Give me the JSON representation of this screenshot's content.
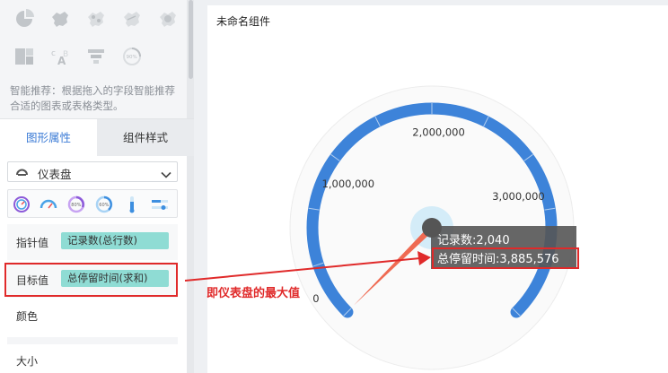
{
  "left_panel": {
    "recommend_text": "智能推荐：根据拖入的字段智能推荐合适的图表或表格类型。",
    "tabs": [
      {
        "label": "图形属性",
        "active": true
      },
      {
        "label": "组件样式",
        "active": false
      }
    ],
    "chart_type_select": {
      "value": "仪表盘"
    },
    "fields": {
      "pointer": {
        "label": "指针值",
        "value": "记录数(总行数)"
      },
      "target": {
        "label": "目标值",
        "value": "总停留时间(求和)"
      },
      "color": {
        "label": "颜色"
      },
      "size": {
        "label": "大小"
      }
    }
  },
  "right_panel": {
    "widget_title": "未命名组件",
    "gauge": {
      "min": 0,
      "max": 3885576,
      "value": 2040,
      "tick_labels": [
        "0",
        "1,000,000",
        "2,000,000",
        "3,000,000"
      ],
      "arc_color": "#3d83d9",
      "pointer_color": "#ef6a52"
    },
    "tooltip": {
      "line1": "记录数:2,040",
      "line2": "总停留时间:3,885,576"
    }
  },
  "annotation": {
    "text": "即仪表盘的最大值",
    "color": "#e02a2a"
  }
}
